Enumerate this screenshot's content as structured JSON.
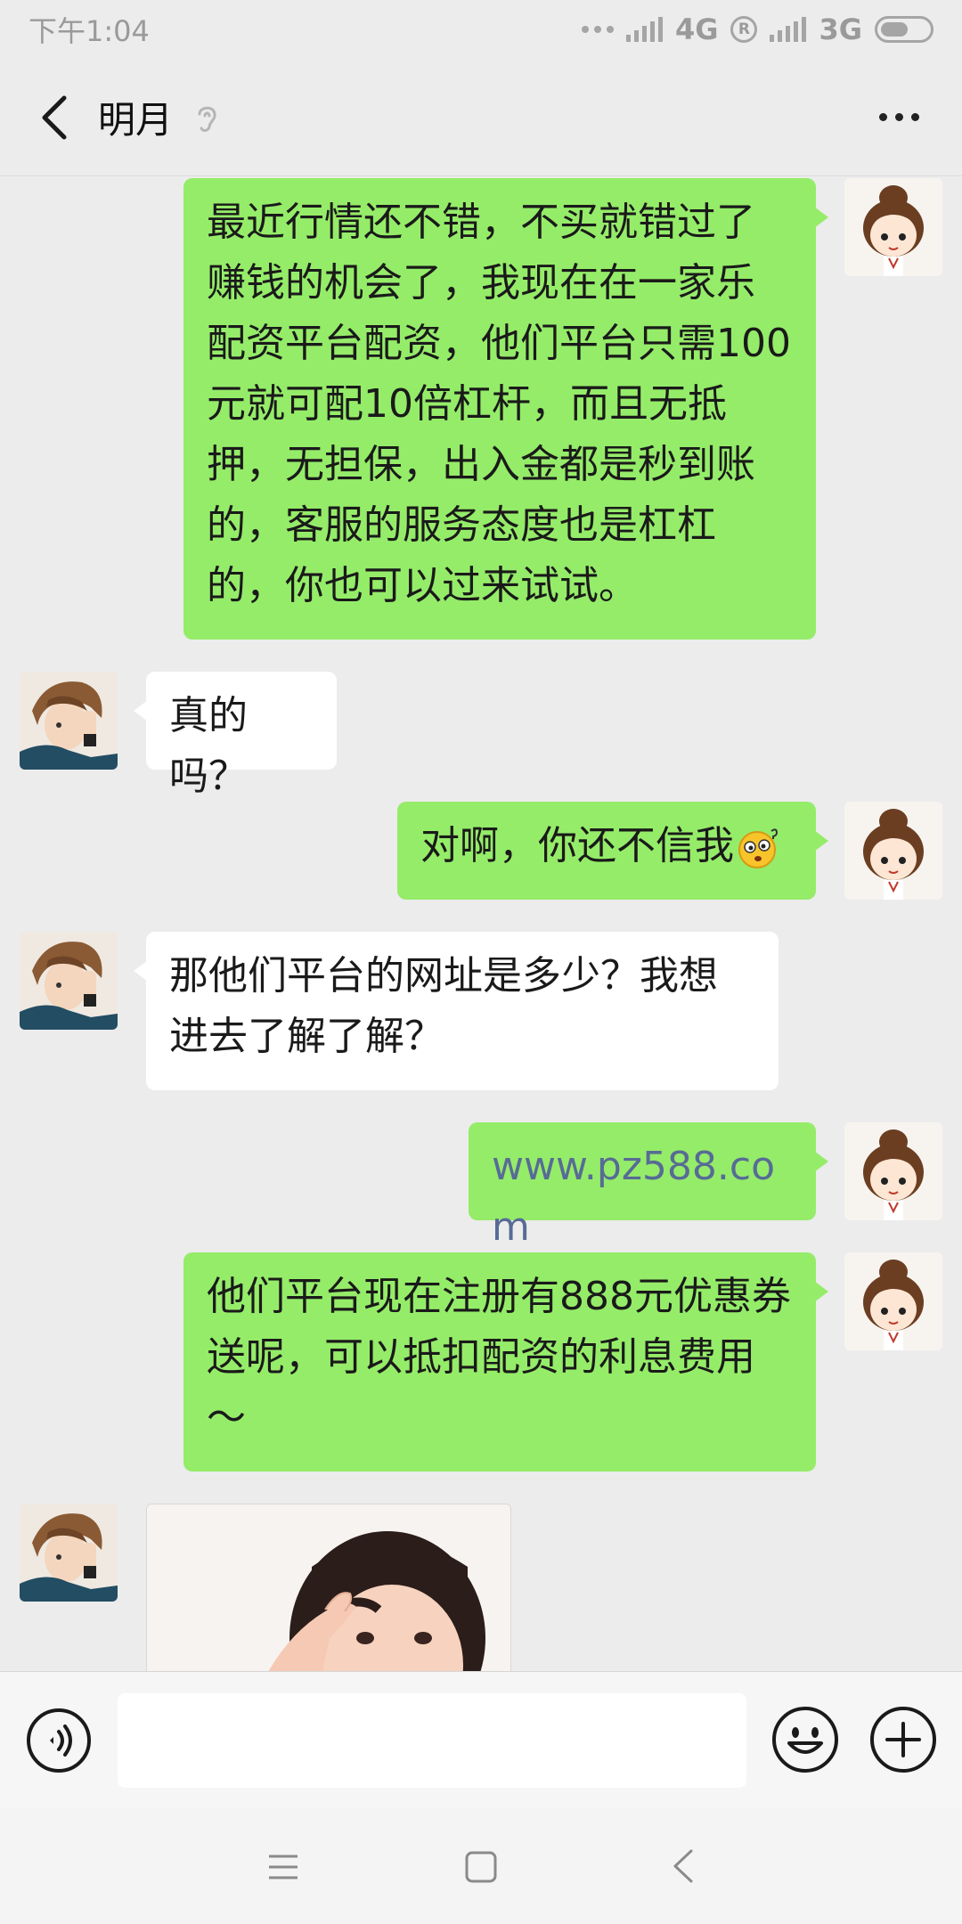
{
  "status_bar": {
    "time": "下午1:04",
    "network_1": "4G",
    "network_2": "3G",
    "roaming": "R"
  },
  "header": {
    "title": "明月"
  },
  "messages": [
    {
      "side": "out",
      "text": "最近行情还不错，不买就错过了赚钱的机会了，我现在在一家乐配资平台配资，他们平台只需100元就可配10倍杠杆，而且无抵押，无担保，出入金都是秒到账的，客服的服务态度也是杠杠的，你也可以过来试试。"
    },
    {
      "side": "in",
      "text": "真的吗？"
    },
    {
      "side": "out",
      "text": "对啊，你还不信我",
      "emoji": "surprised-emoji"
    },
    {
      "side": "in",
      "text": "那他们平台的网址是多少？我想进去了解了解？"
    },
    {
      "side": "out",
      "text": "www.pz588.com"
    },
    {
      "side": "out",
      "text": "他们平台现在注册有888元优惠券送呢，可以抵扣配资的利息费用～"
    },
    {
      "side": "in",
      "type": "image"
    }
  ],
  "input": {
    "value": "",
    "placeholder": ""
  },
  "icons": {
    "back": "chevron-left-icon",
    "ear": "earpiece-icon",
    "more": "more-dots-icon",
    "voice": "voice-icon",
    "emoji": "smiley-icon",
    "plus": "plus-icon"
  },
  "colors": {
    "outgoing_bubble": "#95ec69",
    "incoming_bubble": "#ffffff",
    "background": "#ececec",
    "link": "#576b95"
  }
}
